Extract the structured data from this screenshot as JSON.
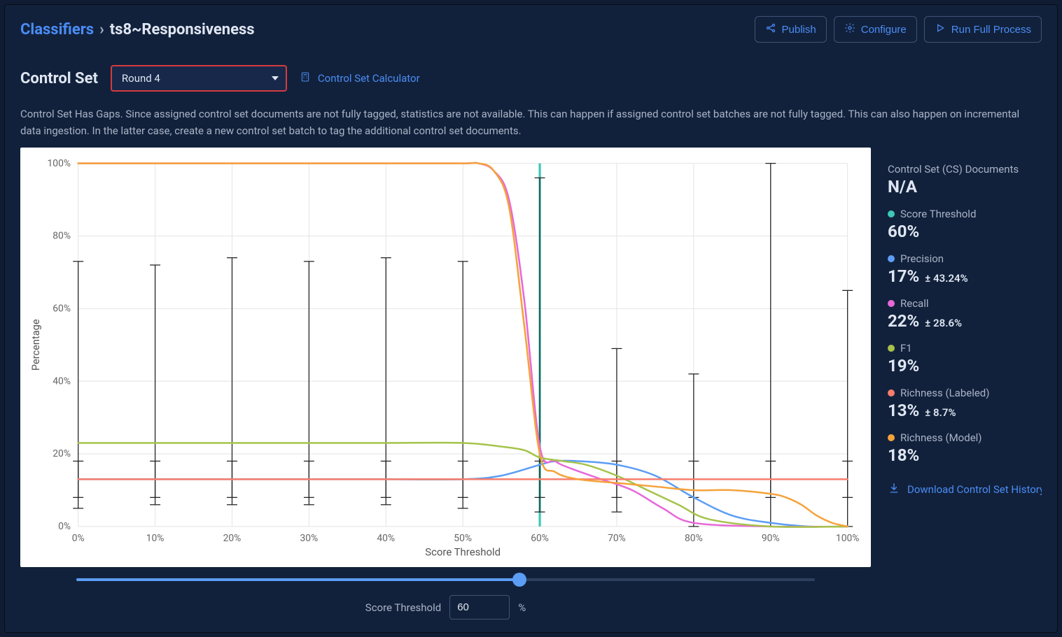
{
  "breadcrumb": {
    "root": "Classifiers",
    "current": "ts8~Responsiveness"
  },
  "buttons": {
    "publish": "Publish",
    "configure": "Configure",
    "run": "Run Full Process"
  },
  "control_set": {
    "label": "Control Set",
    "round": "Round 4",
    "calculator": "Control Set Calculator",
    "warning": "Control Set Has Gaps. Since assigned control set documents are not fully tagged, statistics are not available. This can happen if assigned control set batches are not fully tagged. This can also happen on incremental data ingestion. In the latter case, create a new control set batch to tag the additional control set documents."
  },
  "threshold": {
    "label": "Score Threshold",
    "value": "60",
    "unit": "%"
  },
  "side": {
    "cs_docs": {
      "label": "Control Set (CS) Documents",
      "value": "N/A"
    },
    "score_threshold": {
      "label": "Score Threshold",
      "value": "60%",
      "color": "#3CC8B4"
    },
    "precision": {
      "label": "Precision",
      "value": "17%",
      "pm": "± 43.24%",
      "color": "#5C9DF5"
    },
    "recall": {
      "label": "Recall",
      "value": "22%",
      "pm": "± 28.6%",
      "color": "#E769D9"
    },
    "f1": {
      "label": "F1",
      "value": "19%",
      "color": "#A6C34A"
    },
    "richness_labeled": {
      "label": "Richness (Labeled)",
      "value": "13%",
      "pm": "± 8.7%",
      "color": "#F67E6B"
    },
    "richness_model": {
      "label": "Richness (Model)",
      "value": "18%",
      "color": "#F5A23B"
    },
    "download": "Download Control Set History"
  },
  "chart_data": {
    "type": "line",
    "title": "",
    "xlabel": "Score Threshold",
    "ylabel": "Percentage",
    "xlim": [
      0,
      100
    ],
    "ylim": [
      0,
      100
    ],
    "x_ticks": [
      0,
      10,
      20,
      30,
      40,
      50,
      60,
      70,
      80,
      90,
      100
    ],
    "y_ticks": [
      0,
      20,
      40,
      60,
      80,
      100
    ],
    "threshold_marker": 60,
    "series": [
      {
        "name": "Precision",
        "color": "#5C9DF5",
        "x": [
          0,
          10,
          20,
          30,
          40,
          50,
          55,
          60,
          62,
          65,
          70,
          75,
          80,
          85,
          90,
          95,
          100
        ],
        "y": [
          13,
          13,
          13,
          13,
          13,
          13,
          14,
          17,
          18,
          18,
          17,
          14,
          8,
          3,
          1,
          0,
          0
        ]
      },
      {
        "name": "Recall",
        "color": "#E769D9",
        "x": [
          0,
          10,
          20,
          30,
          40,
          50,
          52,
          54,
          56,
          58,
          60,
          62,
          64,
          68,
          72,
          76,
          80,
          90,
          100
        ],
        "y": [
          100,
          100,
          100,
          100,
          100,
          100,
          100,
          98,
          90,
          62,
          22,
          18,
          16,
          13,
          10,
          5,
          1,
          0,
          0
        ]
      },
      {
        "name": "F1",
        "color": "#A6C34A",
        "x": [
          0,
          10,
          20,
          30,
          40,
          50,
          55,
          58,
          60,
          63,
          66,
          70,
          74,
          78,
          82,
          90,
          100
        ],
        "y": [
          23,
          23,
          23,
          23,
          23,
          23,
          22,
          21,
          19,
          18,
          17,
          14,
          10,
          6,
          2,
          0,
          0
        ]
      },
      {
        "name": "Richness (Labeled)",
        "color": "#F67E6B",
        "x": [
          0,
          100
        ],
        "y": [
          13,
          13
        ]
      },
      {
        "name": "Richness (Model)",
        "color": "#F5A23B",
        "x": [
          0,
          10,
          20,
          30,
          40,
          50,
          52,
          54,
          56,
          58,
          60,
          62,
          65,
          70,
          75,
          80,
          85,
          90,
          92,
          94,
          96,
          98,
          100
        ],
        "y": [
          100,
          100,
          100,
          100,
          100,
          100,
          100,
          98,
          88,
          55,
          20,
          15,
          13,
          12,
          11,
          10,
          10,
          9,
          8,
          6,
          3,
          1,
          0
        ]
      }
    ],
    "error_bars": {
      "x": [
        0,
        10,
        20,
        30,
        40,
        50,
        60,
        70,
        80,
        90,
        100
      ],
      "low": [
        5,
        6,
        6,
        6,
        6,
        5,
        4,
        4,
        0,
        0,
        0
      ],
      "high": [
        73,
        72,
        74,
        73,
        74,
        73,
        96,
        49,
        42,
        100,
        65
      ],
      "low2": [
        8,
        8,
        8,
        8,
        8,
        8,
        8,
        8,
        8,
        8,
        8
      ],
      "high2": [
        18,
        18,
        18,
        18,
        18,
        18,
        18,
        18,
        18,
        18,
        18
      ]
    }
  }
}
